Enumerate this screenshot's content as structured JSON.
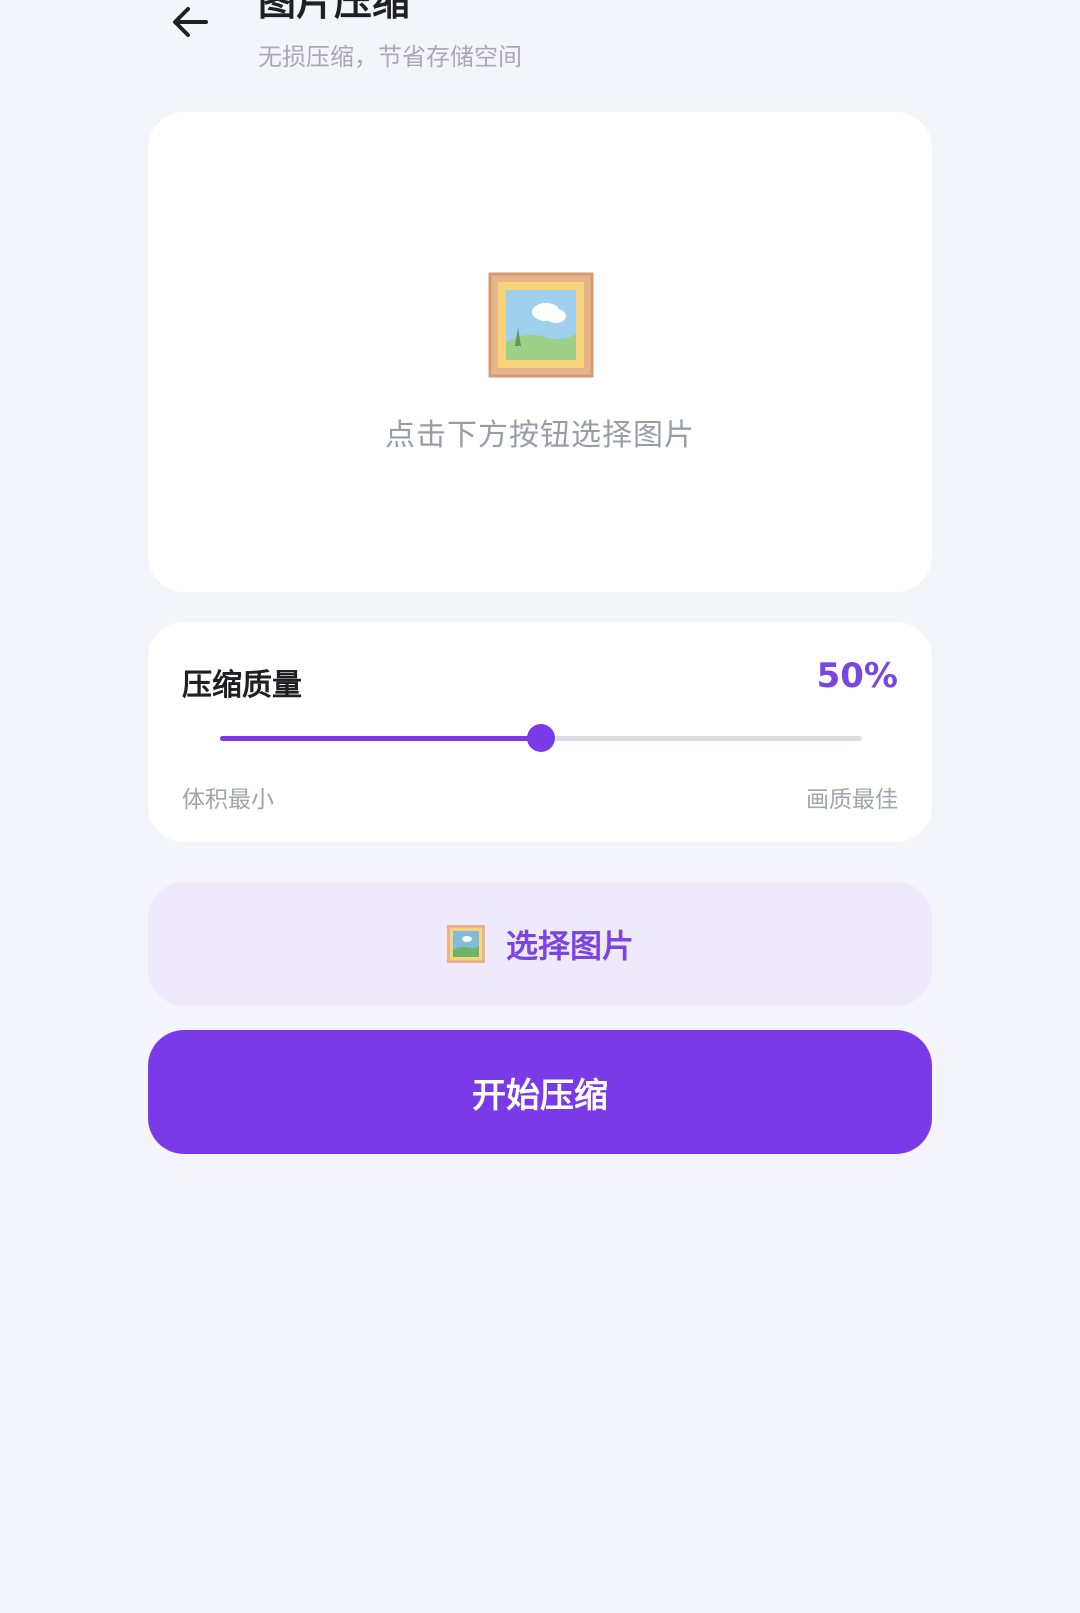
{
  "header": {
    "title": "图片压缩",
    "subtitle": "无损压缩，节省存储空间",
    "back_icon": "arrow-left-icon"
  },
  "preview": {
    "icon": "framed-picture-icon",
    "placeholder": "点击下方按钮选择图片"
  },
  "quality": {
    "label": "压缩质量",
    "value_text": "50%",
    "value": 0.5,
    "min_label": "体积最小",
    "max_label": "画质最佳"
  },
  "actions": {
    "select_label": "选择图片",
    "select_icon": "framed-picture-icon",
    "start_label": "开始压缩"
  },
  "colors": {
    "accent": "#7b3ae8",
    "background": "#f4f5fb",
    "select_button_bg": "#eee9fb"
  }
}
